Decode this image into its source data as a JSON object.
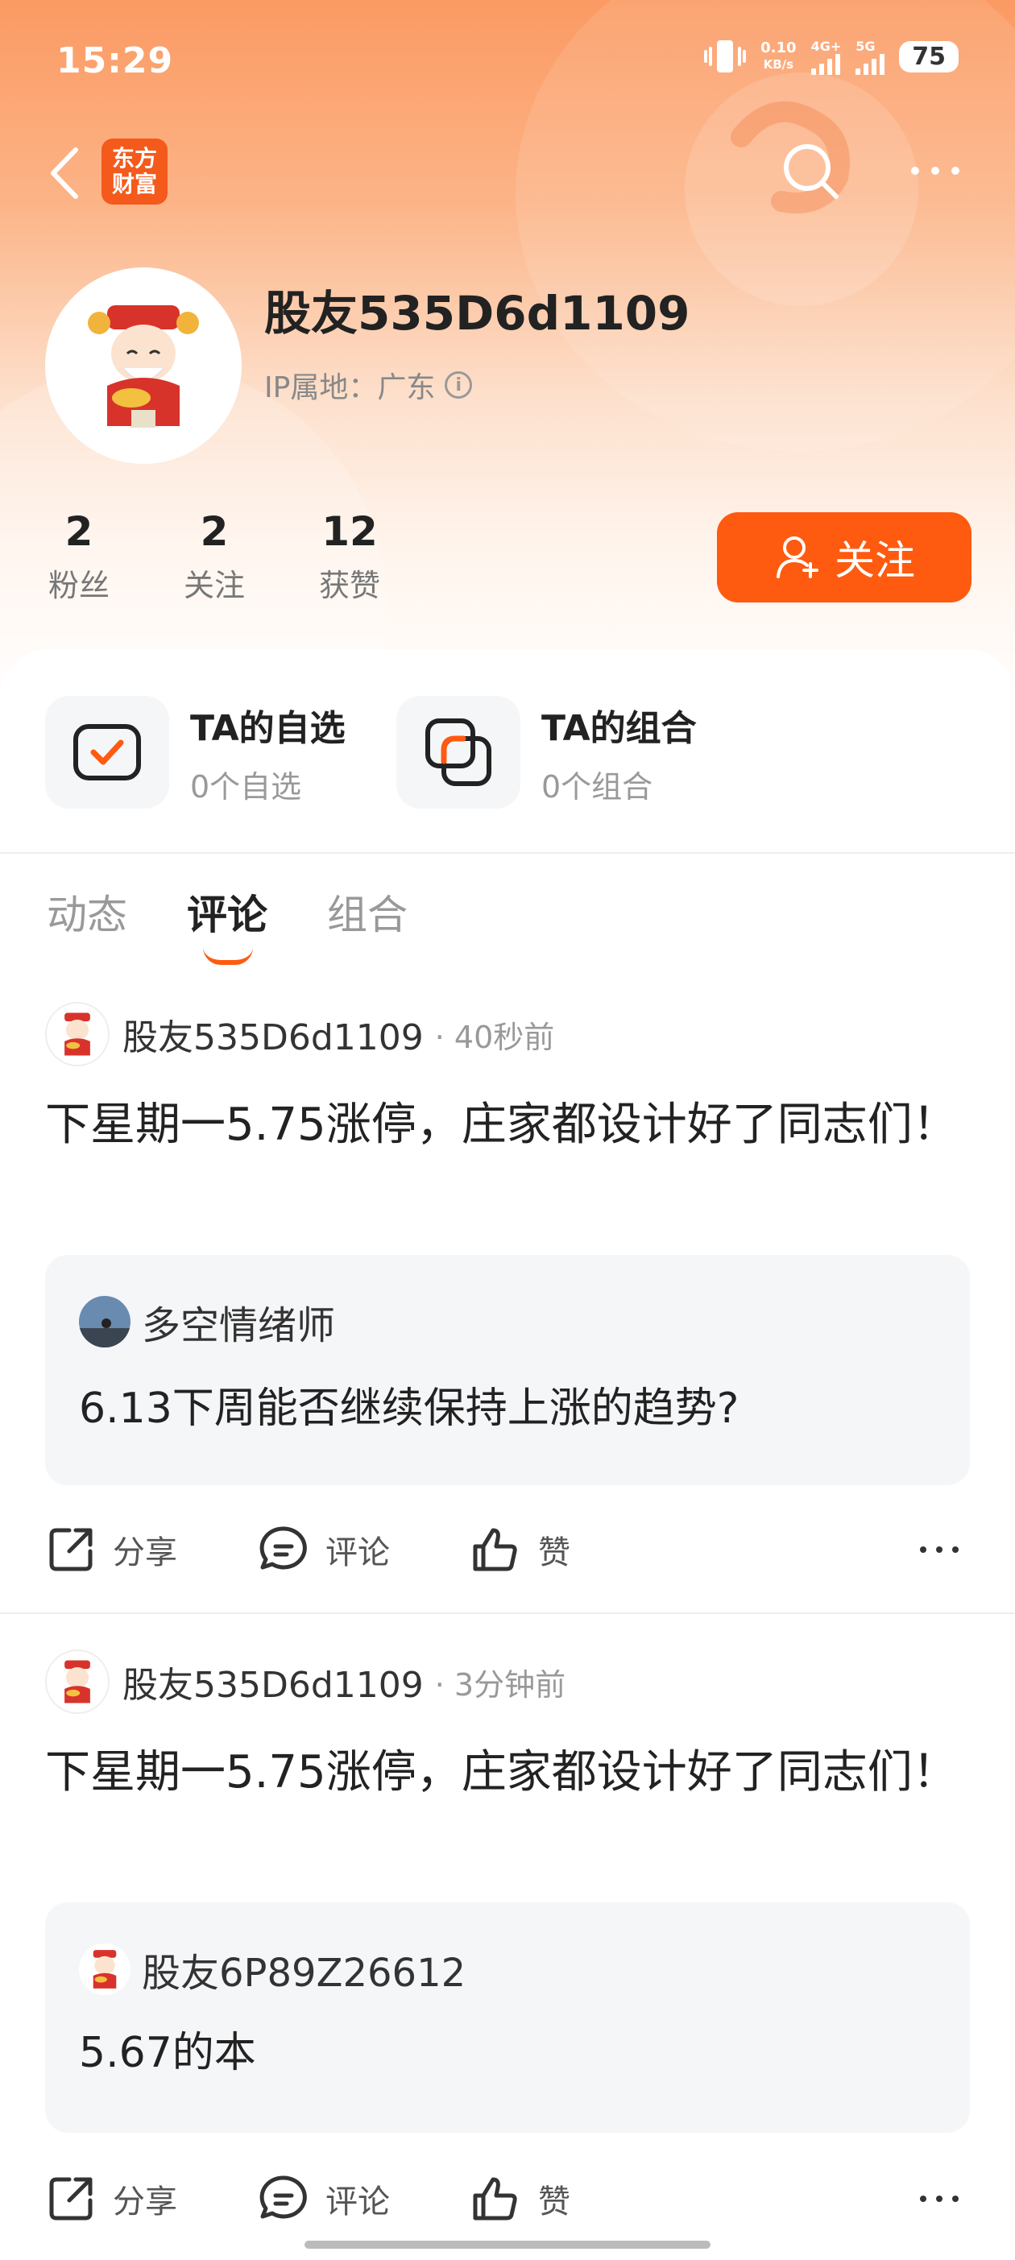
{
  "status_bar": {
    "time": "15:29",
    "speed_value": "0.10",
    "speed_unit": "KB/s",
    "net1": "4G+",
    "net2": "5G",
    "battery": "75"
  },
  "app": {
    "logo_line1": "东方",
    "logo_line2": "财富"
  },
  "profile": {
    "username": "股友535D6d1109",
    "ip_label": "IP属地：广东",
    "stats": [
      {
        "num": "2",
        "label": "粉丝"
      },
      {
        "num": "2",
        "label": "关注"
      },
      {
        "num": "12",
        "label": "获赞"
      }
    ],
    "follow_label": "关注"
  },
  "quick_links": [
    {
      "title": "TA的自选",
      "sub": "0个自选"
    },
    {
      "title": "TA的组合",
      "sub": "0个组合"
    }
  ],
  "tabs": [
    "动态",
    "评论",
    "组合"
  ],
  "active_tab": "评论",
  "posts": [
    {
      "author": "股友535D6d1109",
      "time": "· 40秒前",
      "body": "下星期一5.75涨停，庄家都设计好了同志们！",
      "quote_author": "多空情绪师",
      "quote_text": "6.13下周能否继续保持上涨的趋势?"
    },
    {
      "author": "股友535D6d1109",
      "time": "· 3分钟前",
      "body": "下星期一5.75涨停，庄家都设计好了同志们！",
      "quote_author": "股友6P89Z26612",
      "quote_text": "5.67的本"
    }
  ],
  "actions": {
    "share": "分享",
    "comment": "评论",
    "like": "赞"
  },
  "colors": {
    "accent": "#fe5a10",
    "header_gradient_top": "#fb9a63"
  }
}
